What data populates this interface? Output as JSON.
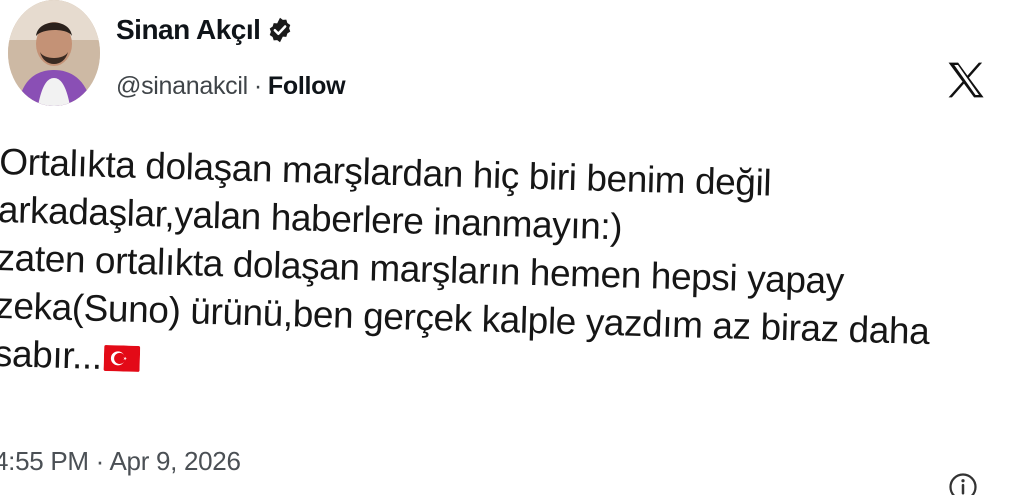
{
  "author": {
    "display_name": "Sinan Akçıl",
    "handle": "@sinanakcil",
    "separator": "·",
    "follow_label": "Follow",
    "avatar_icon": "profile-photo",
    "verified_icon": "verified-badge-icon"
  },
  "platform": {
    "logo_icon": "x-logo-icon"
  },
  "tweet": {
    "lines": [
      "Ortalıkta dolaşan marşlardan hiç biri benim değil",
      "arkadaşlar,yalan haberlere inanmayın:)",
      "zaten ortalıkta dolaşan marşların hemen hepsi yapay",
      "zeka(Suno) ürünü,ben gerçek kalple yazdım az biraz daha",
      "sabır..."
    ],
    "emoji": "turkey-flag-emoji",
    "timestamp": "4:55 PM · Apr 9, 2026"
  },
  "colors": {
    "text": "#111111",
    "muted": "#4b5055",
    "flag_red": "#e30a17",
    "verified_badge": "#1a1a1a"
  }
}
